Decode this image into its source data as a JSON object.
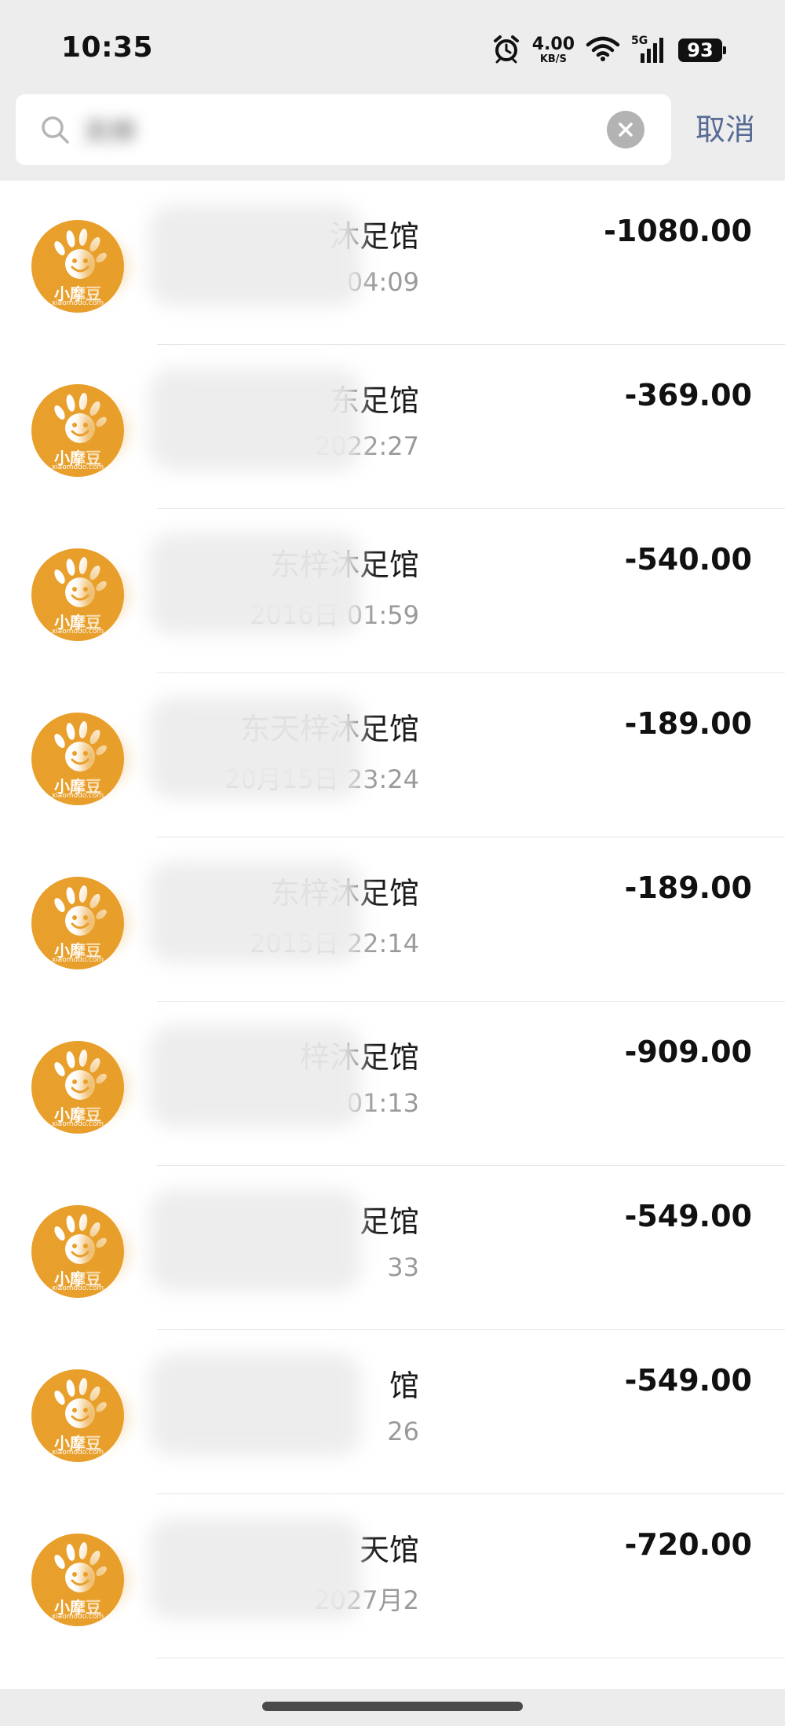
{
  "status_bar": {
    "time": "10:35",
    "net_speed_value": "4.00",
    "net_speed_unit": "KB/S",
    "network_type": "5G",
    "battery": "93",
    "icons": [
      "alarm-icon",
      "wifi-icon",
      "signal-icon",
      "battery-icon"
    ]
  },
  "search": {
    "value": "天梓",
    "placeholder": "",
    "cancel_label": "取消"
  },
  "colors": {
    "accent": "#576b95",
    "avatar_orange": "#e89f2b",
    "secondary_text": "#9a9a9a",
    "background": "#ededed"
  },
  "avatar": {
    "brand": "小摩豆",
    "domain": "xiaomodo.com"
  },
  "transactions": [
    {
      "merchant": "沐足馆",
      "time": "04:09",
      "amount": "-1080.00"
    },
    {
      "merchant": "东足馆",
      "time": "2022:27",
      "amount": "-369.00"
    },
    {
      "merchant": "东梓沐足馆",
      "time": "2016日 01:59",
      "amount": "-540.00"
    },
    {
      "merchant": "东天梓沐足馆",
      "time": "20月15日 23:24",
      "amount": "-189.00"
    },
    {
      "merchant": "东梓沐足馆",
      "time": "2015日 22:14",
      "amount": "-189.00"
    },
    {
      "merchant": "梓沐足馆",
      "time": "01:13",
      "amount": "-909.00"
    },
    {
      "merchant": "足馆",
      "time": "33",
      "amount": "-549.00"
    },
    {
      "merchant": "馆",
      "time": "26",
      "amount": "-549.00"
    },
    {
      "merchant": "天馆",
      "time": "2027月2",
      "amount": "-720.00"
    }
  ]
}
